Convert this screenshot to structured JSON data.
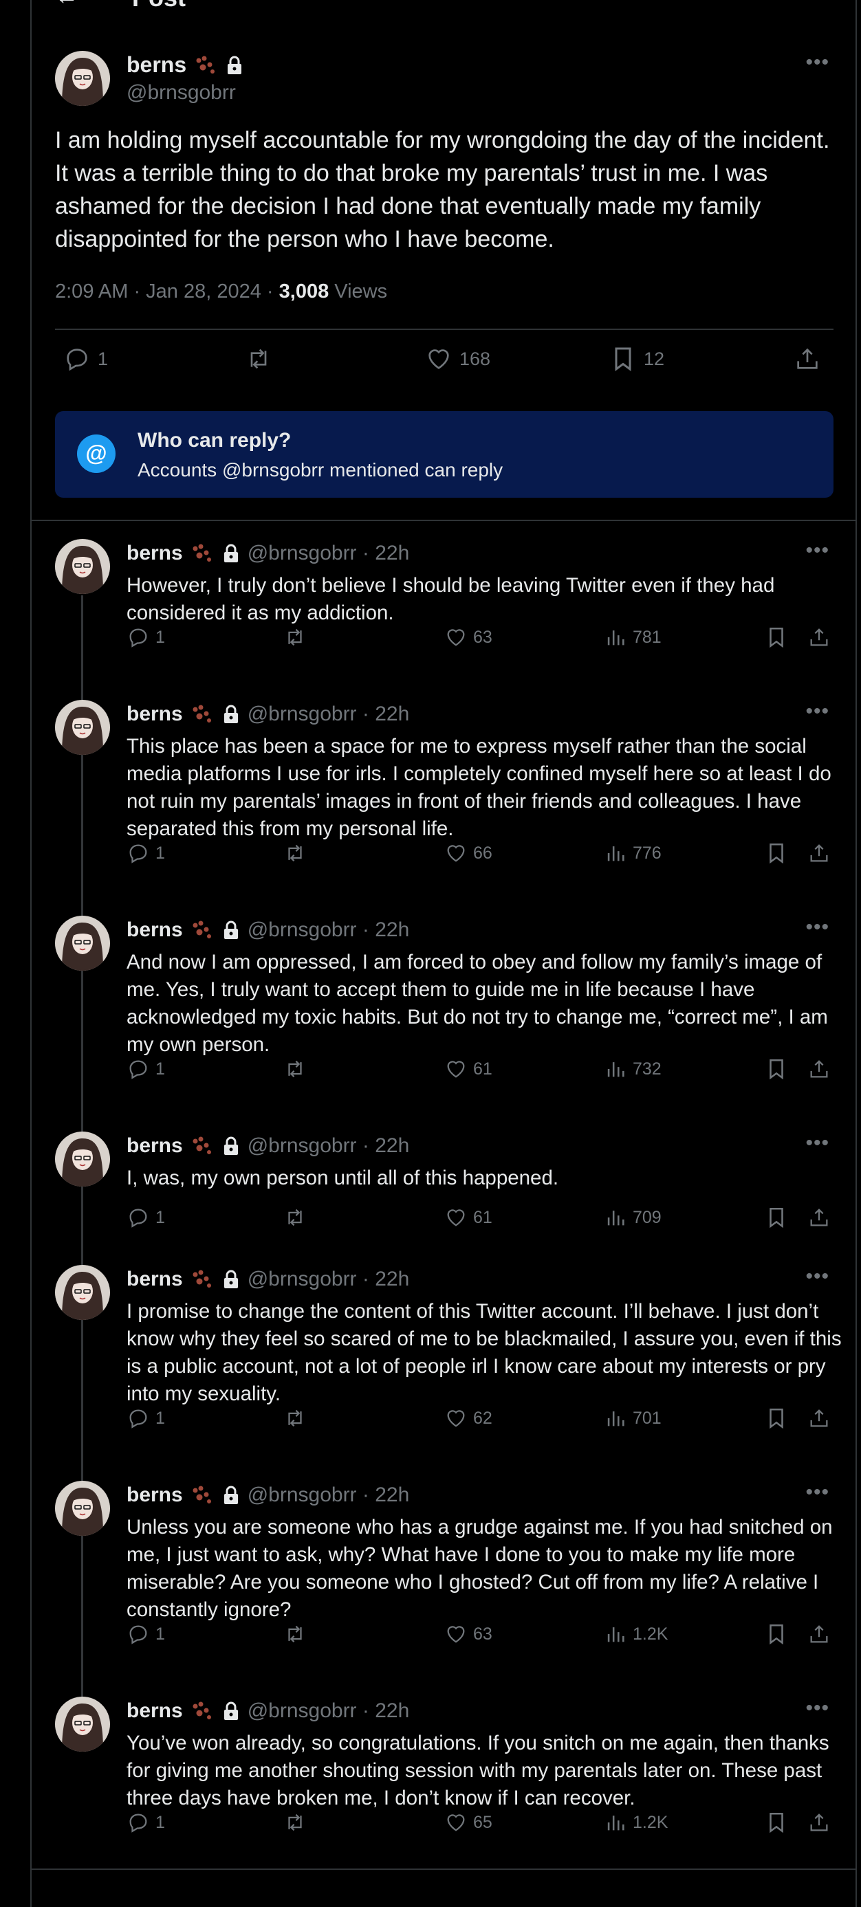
{
  "header": {
    "back_icon": "arrow-left-icon",
    "title": "Post"
  },
  "main_post": {
    "name": "berns",
    "handle": "@brnsgobrr",
    "text": "I am holding myself accountable for my wrongdoing the day of the incident. It was a terrible thing to do that broke my parentals’ trust in me. I was ashamed for the decision I had done that eventually made my family disappointed for the person who I have become.",
    "time": "2:09 AM · Jan 28, 2024 · ",
    "views_count": "3,008",
    "views_label": "Views",
    "replies": "1",
    "likes": "168",
    "bookmarks": "12"
  },
  "who_can_reply": {
    "icon": "@",
    "title": "Who can reply?",
    "subtitle": "Accounts @brnsgobrr mentioned can reply"
  },
  "replies": [
    {
      "name": "berns",
      "handle": "@brnsgobrr · 22h",
      "text": "However, I truly don’t believe I should be leaving Twitter even if they had considered it as my addiction.",
      "replies": "1",
      "likes": "63",
      "views": "781"
    },
    {
      "name": "berns",
      "handle": "@brnsgobrr · 22h",
      "text": "This place has been a space for me to express myself rather than the social media platforms I use for irls. I completely confined myself here so at least I do not ruin my parentals’ images in front of their friends and colleagues. I have separated this from my personal life.",
      "replies": "1",
      "likes": "66",
      "views": "776"
    },
    {
      "name": "berns",
      "handle": "@brnsgobrr · 22h",
      "text": "And now I am oppressed, I am forced to obey and follow my family’s image of me. Yes, I truly want to accept them to guide me in life because I have acknowledged my toxic habits. But do not try to change me, “correct me”, I am my own person.",
      "replies": "1",
      "likes": "61",
      "views": "732"
    },
    {
      "name": "berns",
      "handle": "@brnsgobrr · 22h",
      "text": "I, was, my own person until all of this happened.",
      "replies": "1",
      "likes": "61",
      "views": "709"
    },
    {
      "name": "berns",
      "handle": "@brnsgobrr · 22h",
      "text": "I promise to change the content of this Twitter account. I’ll behave. I just don’t know why they feel so scared of me to be blackmailed, I assure you, even if this is a public account, not a lot of people irl I know care about my interests or pry into my sexuality.",
      "replies": "1",
      "likes": "62",
      "views": "701"
    },
    {
      "name": "berns",
      "handle": "@brnsgobrr · 22h",
      "text": "Unless you are someone who has a grudge against me. If you had snitched on me, I just want to ask, why? What have I done to you to make my life more miserable? Are you someone who I ghosted? Cut off from my life? A relative I constantly ignore?",
      "replies": "1",
      "likes": "63",
      "views": "1.2K"
    },
    {
      "name": "berns",
      "handle": "@brnsgobrr · 22h",
      "text": "You’ve won already, so congratulations. If you snitch on me again, then thanks for giving me another shouting session with my parentals later on. These past three days have broken me, I don’t know if I can recover.",
      "replies": "1",
      "likes": "65",
      "views": "1.2K"
    }
  ],
  "icons": {
    "name_badges": [
      "paw-icon",
      "lock-icon"
    ],
    "actions": [
      "reply-icon",
      "repost-icon",
      "like-icon",
      "views-icon",
      "bookmark-icon",
      "share-icon"
    ],
    "more": "more-icon"
  },
  "colors": {
    "accent": "#1d9bf0",
    "reply_box_bg": "#071a4d",
    "muted": "#71767b",
    "paw": "#a0493a"
  }
}
